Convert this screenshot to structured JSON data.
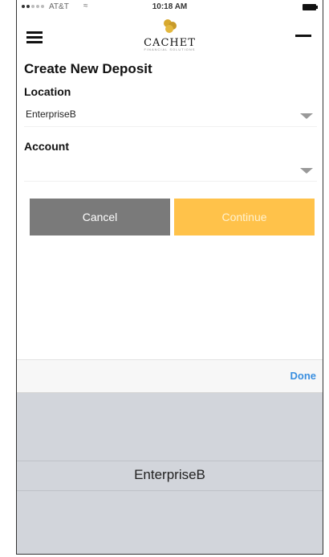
{
  "status_bar": {
    "carrier": "AT&T",
    "time": "10:18 AM"
  },
  "nav": {
    "logo_text": "CACHET",
    "logo_subtext": "FINANCIAL SOLUTIONS"
  },
  "page": {
    "title": "Create New Deposit"
  },
  "form": {
    "location": {
      "label": "Location",
      "value": "EnterpriseB"
    },
    "account": {
      "label": "Account",
      "value": ""
    }
  },
  "buttons": {
    "cancel": "Cancel",
    "continue": "Continue"
  },
  "keyboard_accessory": {
    "done": "Done"
  },
  "picker": {
    "selected": "EnterpriseB"
  },
  "colors": {
    "cancel_bg": "#7a7a7a",
    "continue_bg": "#ffc24a",
    "done_text": "#3a8fe0",
    "picker_bg": "#d2d5db"
  }
}
